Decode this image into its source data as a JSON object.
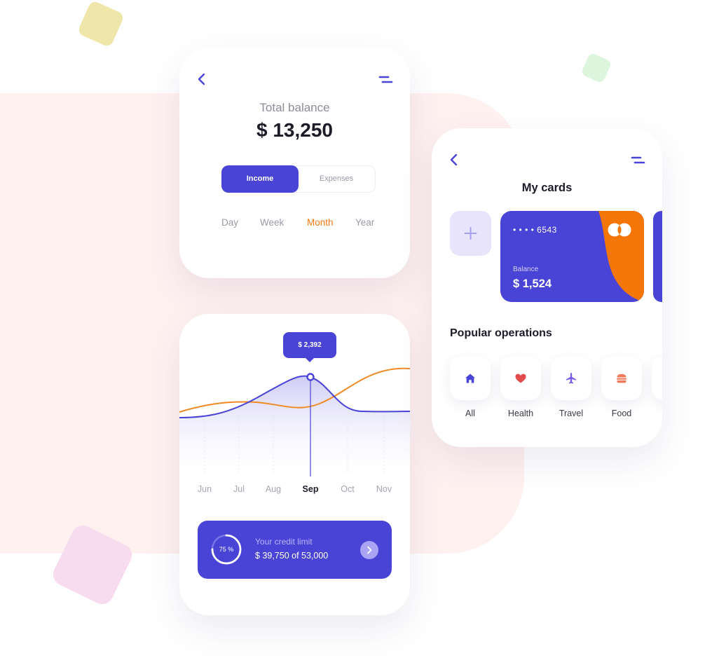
{
  "balance_screen": {
    "total_label": "Total balance",
    "total_value": "$ 13,250",
    "segments": {
      "income": "Income",
      "expenses": "Expenses"
    },
    "periods": [
      "Day",
      "Week",
      "Month",
      "Year"
    ],
    "active_period": "Month"
  },
  "chart_screen": {
    "tooltip": "$ 2,392",
    "months": [
      "Jun",
      "Jul",
      "Aug",
      "Sep",
      "Oct",
      "Nov"
    ],
    "active_month": "Sep",
    "credit": {
      "percent": "75 %",
      "percent_value": 75,
      "title": "Your credit limit",
      "value": "$ 39,750 of 53,000"
    }
  },
  "cards_screen": {
    "title": "My cards",
    "card": {
      "number": "• • • •  6543",
      "balance_label": "Balance",
      "balance_value": "$ 1,524"
    },
    "operations_title": "Popular operations",
    "operations": [
      {
        "label": "All",
        "icon": "home-icon"
      },
      {
        "label": "Health",
        "icon": "heart-icon"
      },
      {
        "label": "Travel",
        "icon": "airplane-icon"
      },
      {
        "label": "Food",
        "icon": "burger-icon"
      }
    ]
  },
  "colors": {
    "accent": "#4a44d6",
    "orange": "#f07a10",
    "background_blob": "#fff1f0"
  }
}
